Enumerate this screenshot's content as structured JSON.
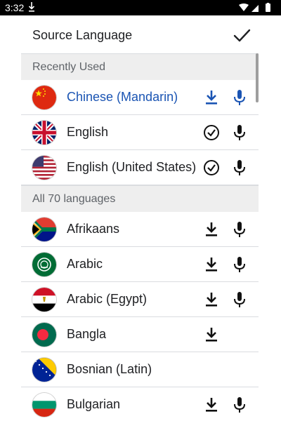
{
  "status_bar": {
    "time": "3:32"
  },
  "app_bar": {
    "title": "Source Language",
    "confirm_icon": "check-icon"
  },
  "sections": {
    "recent": {
      "label": "Recently Used"
    },
    "all": {
      "label": "All 70 languages"
    }
  },
  "recent_languages": [
    {
      "label": "Chinese (Mandarin)",
      "selected": true,
      "flag": "china",
      "actions": [
        "download",
        "mic"
      ]
    },
    {
      "label": "English",
      "selected": false,
      "flag": "uk",
      "actions": [
        "downloaded-check",
        "mic"
      ]
    },
    {
      "label": "English (United States)",
      "selected": false,
      "flag": "usa",
      "actions": [
        "downloaded-check",
        "mic"
      ]
    }
  ],
  "all_languages": [
    {
      "label": "Afrikaans",
      "flag": "south-africa",
      "actions": [
        "download",
        "mic"
      ]
    },
    {
      "label": "Arabic",
      "flag": "arab-league",
      "actions": [
        "download",
        "mic"
      ]
    },
    {
      "label": "Arabic (Egypt)",
      "flag": "egypt",
      "actions": [
        "download",
        "mic"
      ]
    },
    {
      "label": "Bangla",
      "flag": "bangladesh",
      "actions": [
        "download"
      ]
    },
    {
      "label": "Bosnian (Latin)",
      "flag": "bosnia",
      "actions": []
    },
    {
      "label": "Bulgarian",
      "flag": "bulgaria",
      "actions": [
        "download",
        "mic"
      ]
    }
  ],
  "colors": {
    "accent_blue": "#1a54b3",
    "icon_dark": "#111111",
    "section_bg": "#eeeeee",
    "divider": "#dadce0"
  }
}
